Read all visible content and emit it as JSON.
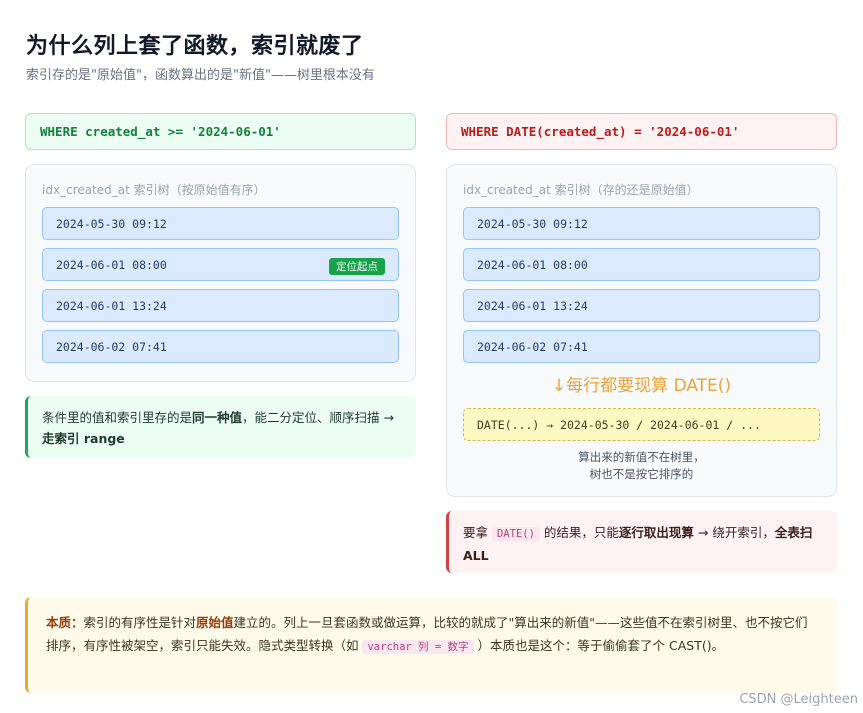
{
  "header": {
    "title": "为什么列上套了函数，索引就废了",
    "subtitle": "索引存的是\"原始值\"，函数算出的是\"新值\"——树里根本没有"
  },
  "left": {
    "query": "WHERE created_at >= '2024-06-01'",
    "tree_label": "idx_created_at 索引树（按原始值有序）",
    "rows": [
      "2024-05-30 09:12",
      "2024-06-01 08:00",
      "2024-06-01 13:24",
      "2024-06-02 07:41"
    ],
    "badge": "定位起点",
    "callout": {
      "text1": "条件里的值和索引里存的是",
      "bold1": "同一种值",
      "text2": "，能二分定位、顺序扫描 → ",
      "bold2": "走索引 range"
    }
  },
  "right": {
    "query": "WHERE DATE(created_at) = '2024-06-01'",
    "tree_label": "idx_created_at 索引树（存的还是原始值）",
    "rows": [
      "2024-05-30 09:12",
      "2024-06-01 08:00",
      "2024-06-01 13:24",
      "2024-06-02 07:41"
    ],
    "compute_label": "↓每行都要现算 DATE()",
    "compute_box": "DATE(...) → 2024-05-30 / 2024-06-01 / ...",
    "compute_note_1": "算出来的新值不在树里，",
    "compute_note_2": "树也不是按它排序的",
    "callout": {
      "text1": "要拿 ",
      "code": "DATE()",
      "text2": " 的结果，只能",
      "bold1": "逐行取出现算",
      "text3": " → 绕开索引，",
      "bold2": "全表扫 ALL"
    }
  },
  "bottom": {
    "bold1": "本质：",
    "text1": "索引的有序性是针对",
    "bold2": "原始值",
    "text2": "建立的。列上一旦套函数或做运算，比较的就成了\"算出来的新值\"——这些值不在索引树里、也不按它们排序，有序性被架空，索引只能失效。隐式类型转换（如 ",
    "code": "varchar 列 = 数字",
    "text3": " ）本质也是这个：等于偷偷套了个 CAST()。"
  },
  "watermark": "CSDN @Leighteen",
  "colors": {
    "good": "#15803d",
    "bad": "#b91c1c",
    "row_bg": "#dbeafe",
    "badge": "#16a34a",
    "accent_orange": "#e8a33d"
  }
}
